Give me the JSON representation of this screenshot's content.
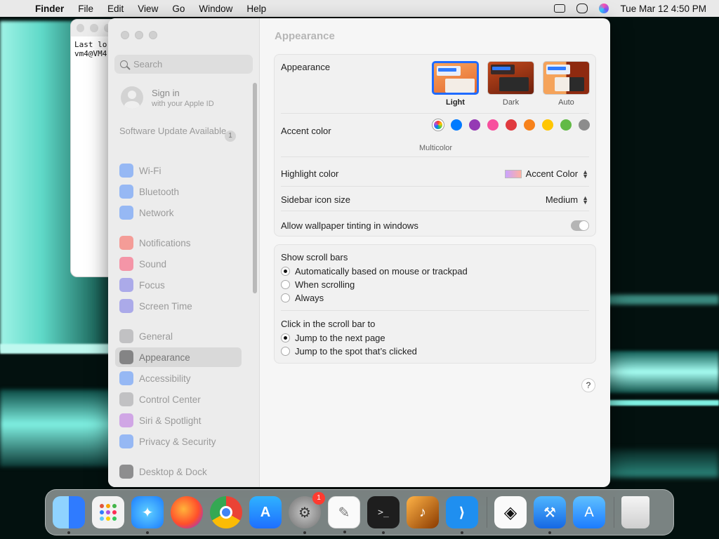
{
  "menubar": {
    "app": "Finder",
    "menus": [
      "File",
      "Edit",
      "View",
      "Go",
      "Window",
      "Help"
    ],
    "datetime": "Tue Mar 12  4:50 PM"
  },
  "terminal": {
    "line1": "Last lo",
    "line2": "vm4@VM4"
  },
  "settings": {
    "search_placeholder": "Search",
    "account": {
      "title": "Sign in",
      "subtitle": "with your Apple ID"
    },
    "update": {
      "label": "Software Update Available",
      "count": "1"
    },
    "sidebar": [
      {
        "label": "Wi-Fi",
        "icon": "wifi-icon",
        "color": "#2f7bff"
      },
      {
        "label": "Bluetooth",
        "icon": "bluetooth-icon",
        "color": "#2f7bff"
      },
      {
        "label": "Network",
        "icon": "network-icon",
        "color": "#2f7bff"
      },
      {
        "label": "Notifications",
        "icon": "notifications-icon",
        "color": "#ff3b30"
      },
      {
        "label": "Sound",
        "icon": "sound-icon",
        "color": "#ff2d55"
      },
      {
        "label": "Focus",
        "icon": "focus-icon",
        "color": "#5e5ce6"
      },
      {
        "label": "Screen Time",
        "icon": "screen-time-icon",
        "color": "#5e5ce6"
      },
      {
        "label": "General",
        "icon": "gear-icon",
        "color": "#8e8e93"
      },
      {
        "label": "Appearance",
        "icon": "appearance-icon",
        "color": "#1c1c1e"
      },
      {
        "label": "Accessibility",
        "icon": "accessibility-icon",
        "color": "#2f7bff"
      },
      {
        "label": "Control Center",
        "icon": "control-center-icon",
        "color": "#8e8e93"
      },
      {
        "label": "Siri & Spotlight",
        "icon": "siri-icon",
        "color": "#af52de"
      },
      {
        "label": "Privacy & Security",
        "icon": "privacy-icon",
        "color": "#2f7bff"
      },
      {
        "label": "Desktop & Dock",
        "icon": "desktop-dock-icon",
        "color": "#1c1c1e"
      }
    ],
    "selected": "Appearance",
    "main": {
      "title": "Appearance",
      "appearance_label": "Appearance",
      "modes": [
        "Light",
        "Dark",
        "Auto"
      ],
      "selected_mode": "Light",
      "accent_label": "Accent color",
      "accent_caption": "Multicolor",
      "accent_colors": [
        "#007aff",
        "#953ab4",
        "#f74f9e",
        "#e03a3e",
        "#f7821b",
        "#ffc600",
        "#62ba46",
        "#8c8c8c"
      ],
      "highlight_label": "Highlight color",
      "highlight_value": "Accent Color",
      "icon_size_label": "Sidebar icon size",
      "icon_size_value": "Medium",
      "tinting_label": "Allow wallpaper tinting in windows",
      "scrollbars_label": "Show scroll bars",
      "scroll_options": [
        "Automatically based on mouse or trackpad",
        "When scrolling",
        "Always"
      ],
      "click_label": "Click in the scroll bar to",
      "click_options": [
        "Jump to the next page",
        "Jump to the spot that’s clicked"
      ],
      "help": "?"
    }
  },
  "dock": {
    "badge": "1"
  }
}
